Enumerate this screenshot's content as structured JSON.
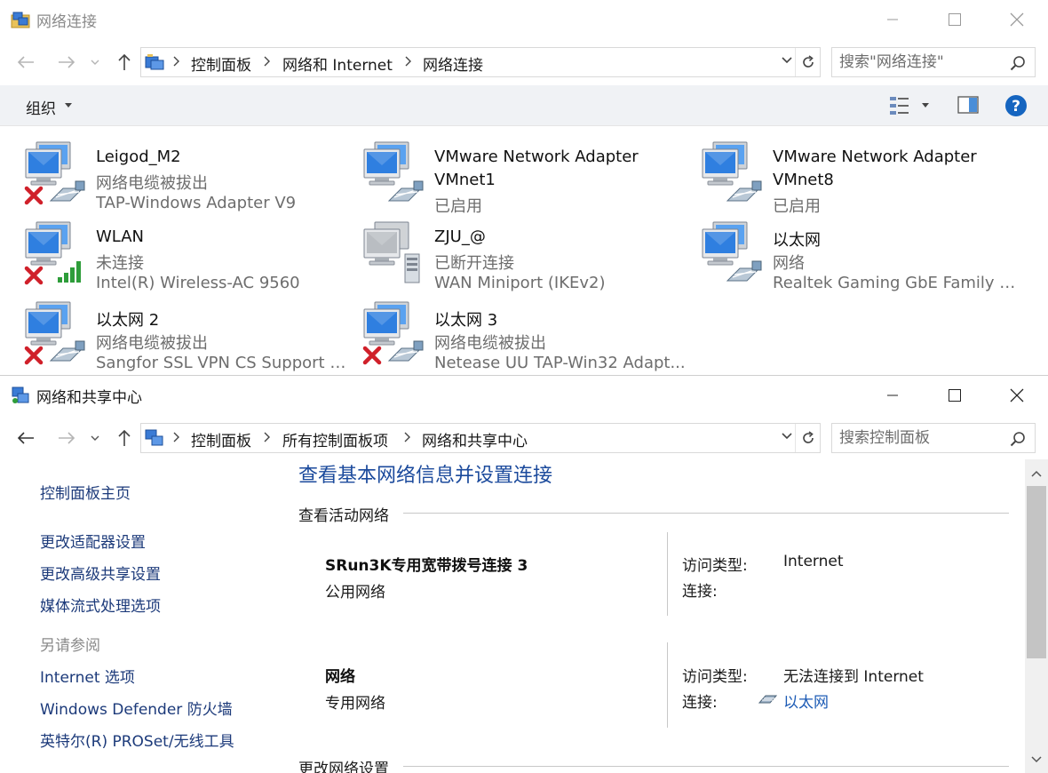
{
  "window1": {
    "title": "网络连接",
    "address": [
      "控制面板",
      "网络和 Internet",
      "网络连接"
    ],
    "search_placeholder": "搜索\"网络连接\"",
    "organize_label": "组织",
    "connections": [
      {
        "name": "Leigod_M2",
        "line2": "网络电缆被拔出",
        "line3": "TAP-Windows Adapter V9",
        "status": "disconnected",
        "kind": "cable"
      },
      {
        "name": "VMware Network Adapter",
        "name2": "VMnet1",
        "line3": "已启用",
        "status": "enabled",
        "kind": "cable"
      },
      {
        "name": "VMware Network Adapter",
        "name2": "VMnet8",
        "line3": "已启用",
        "status": "enabled",
        "kind": "cable"
      },
      {
        "name": "WLAN",
        "line2": "未连接",
        "line3": "Intel(R) Wireless-AC 9560",
        "status": "disconnected",
        "kind": "wifi"
      },
      {
        "name": "ZJU_@",
        "line2": "已断开连接",
        "line3": "WAN Miniport (IKEv2)",
        "status": "offline",
        "kind": "vpn"
      },
      {
        "name": "以太网",
        "line2": "网络",
        "line3": "Realtek Gaming GbE Family Co...",
        "status": "connected",
        "kind": "cable"
      },
      {
        "name": "以太网 2",
        "line2": "网络电缆被拔出",
        "line3": "Sangfor SSL VPN CS Support S...",
        "status": "disconnected",
        "kind": "cable"
      },
      {
        "name": "以太网 3",
        "line2": "网络电缆被拔出",
        "line3": "Netease UU TAP-Win32 Adapt...",
        "status": "disconnected",
        "kind": "cable"
      }
    ]
  },
  "window2": {
    "title": "网络和共享中心",
    "address": [
      "控制面板",
      "所有控制面板项",
      "网络和共享中心"
    ],
    "search_placeholder": "搜索控制面板",
    "leftnav": {
      "home": "控制面板主页",
      "links": [
        "更改适配器设置",
        "更改高级共享设置",
        "媒体流式处理选项"
      ],
      "see_also": "另请参阅",
      "see_also_links": [
        "Internet 选项",
        "Windows Defender 防火墙",
        "英特尔(R) PROSet/无线工具"
      ]
    },
    "heading": "查看基本网络信息并设置连接",
    "active_networks_label": "查看活动网络",
    "networks": [
      {
        "name": "SRun3K专用宽带拨号连接 3",
        "type": "公用网络",
        "access_label": "访问类型:",
        "access_value": "Internet",
        "conn_label": "连接:",
        "conn_value": ""
      },
      {
        "name": "网络",
        "type": "专用网络",
        "access_label": "访问类型:",
        "access_value": "无法连接到 Internet",
        "conn_label": "连接:",
        "conn_value": "以太网"
      }
    ],
    "change_settings_label": "更改网络设置"
  },
  "colors": {
    "link": "#1c3a7a",
    "heading": "#1b4a9c",
    "cmdbar": "#f0f2f5",
    "error_red": "#d0202a"
  }
}
